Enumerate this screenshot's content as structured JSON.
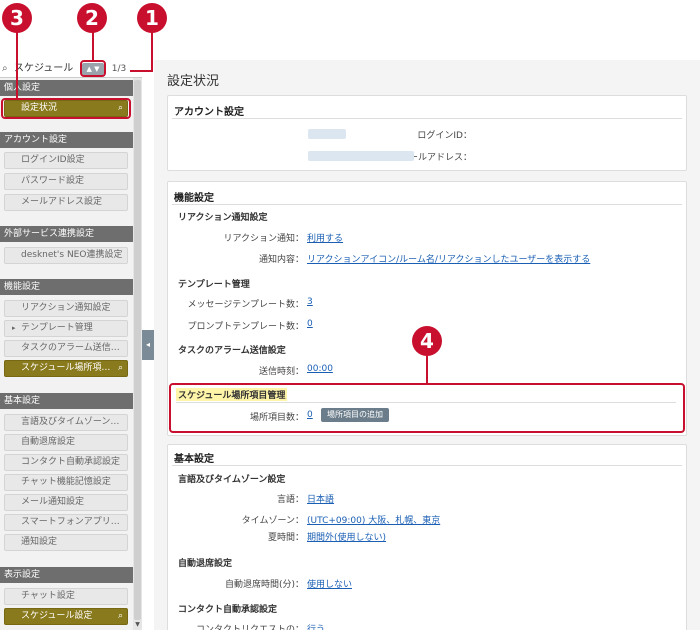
{
  "markers": [
    "1",
    "2",
    "3",
    "4"
  ],
  "sidebar": {
    "search": {
      "value": "スケジュール",
      "arrows": "▲ ▼",
      "count": "1/3"
    },
    "sections": [
      {
        "title": "個人設定",
        "items": [
          {
            "label": "設定状況",
            "active": true
          }
        ]
      },
      {
        "title": "アカウント設定",
        "items": [
          {
            "label": "ログインID設定"
          },
          {
            "label": "パスワード設定"
          },
          {
            "label": "メールアドレス設定"
          }
        ]
      },
      {
        "title": "外部サービス連携設定",
        "items": [
          {
            "label": "desknet's NEO連携設定"
          }
        ]
      },
      {
        "title": "機能設定",
        "items": [
          {
            "label": "リアクション通知設定"
          },
          {
            "label": "テンプレート管理"
          },
          {
            "label": "タスクのアラーム送信…"
          },
          {
            "label": "スケジュール場所項…",
            "active": true
          }
        ]
      },
      {
        "title": "基本設定",
        "items": [
          {
            "label": "言語及びタイムゾーン…"
          },
          {
            "label": "自動退席設定"
          },
          {
            "label": "コンタクト自動承認設定"
          },
          {
            "label": "チャット機能記憶設定"
          },
          {
            "label": "メール通知設定"
          },
          {
            "label": "スマートフォンアプリ…"
          },
          {
            "label": "通知設定"
          }
        ]
      },
      {
        "title": "表示設定",
        "items": [
          {
            "label": "チャット設定"
          },
          {
            "label": "スケジュール設定",
            "active": true
          }
        ]
      }
    ]
  },
  "main": {
    "title": "設定状況",
    "account": {
      "title": "アカウント設定",
      "login_id_label": "ログインID：",
      "email_label": "メールアドレス："
    },
    "features": {
      "title": "機能設定",
      "reaction": {
        "title": "リアクション通知設定",
        "notify_label": "リアクション通知：",
        "notify_value": "利用する",
        "content_label": "通知内容：",
        "content_value": "リアクションアイコン/ルーム名/リアクションしたユーザーを表示する"
      },
      "template": {
        "title": "テンプレート管理",
        "message_label": "メッセージテンプレート数：",
        "message_value": "3",
        "prompt_label": "プロンプトテンプレート数：",
        "prompt_value": "0"
      },
      "task_alarm": {
        "title": "タスクのアラーム送信設定",
        "time_label": "送信時刻：",
        "time_value": "00:00"
      },
      "schedule_place": {
        "title": "スケジュール場所項目管理",
        "count_label": "場所項目数：",
        "count_value": "0",
        "add_button": "場所項目の追加"
      }
    },
    "basic": {
      "title": "基本設定",
      "lang": {
        "title": "言語及びタイムゾーン設定",
        "lang_label": "言語：",
        "lang_value": "日本語",
        "tz_label": "タイムゾーン：",
        "tz_value": "(UTC+09:00) 大阪、札幌、東京",
        "dst_label": "夏時間：",
        "dst_value": "期間外(使用しない)"
      },
      "away": {
        "title": "自動退席設定",
        "time_label": "自動退席時間(分)：",
        "time_value": "使用しない"
      },
      "contact": {
        "title": "コンタクト自動承認設定",
        "request_label": "コンタクトリクエストの：",
        "request_value": "行う"
      }
    }
  },
  "colors": {
    "marker": "#c8102e",
    "active_item": "#8a7a1e",
    "link": "#1a5fb4",
    "highlight": "#fff5a8"
  }
}
